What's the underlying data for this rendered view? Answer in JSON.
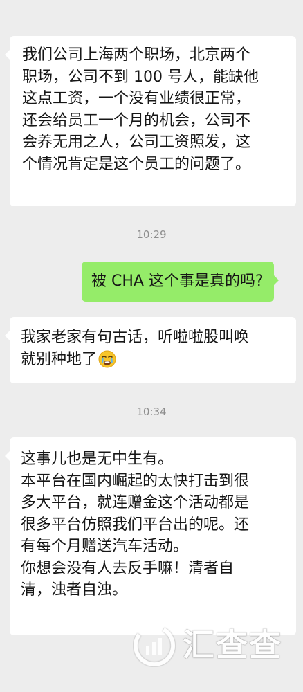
{
  "chat": {
    "messages": [
      {
        "direction": "incoming",
        "text": "我们公司上海两个职场，北京两个\n职场，公司不到 100 号人，能缺他\n这点工资，一个没有业绩很正常，\n还会给员工一个月的机会，公司不\n会养无用之人，公司工资照发，这\n个情况肯定是这个员工的问题了。"
      },
      {
        "direction": "outgoing",
        "text": "被 CHA 这个事是真的吗?"
      },
      {
        "direction": "incoming",
        "text": "我家老家有句古话，听啦啦股叫唤\n就别种地了",
        "emoji": "crying-face"
      },
      {
        "direction": "incoming",
        "text": "这事儿也是无中生有。\n本平台在国内崛起的太快打击到很\n多大平台，就连赠金这个活动都是\n很多平台仿照我们平台出的呢。还\n有每个月赠送汽车活动。\n你想会没有人去反手嘛！清者自\n清，浊者自浊。"
      }
    ],
    "timestamps": [
      "10:29",
      "10:34"
    ]
  },
  "watermark": {
    "text": "汇查查",
    "icon": "chart-circle-logo"
  },
  "colors": {
    "background": "#ededed",
    "incoming_bubble": "#ffffff",
    "outgoing_bubble": "#95ec69",
    "timestamp_text": "#8d8d8d"
  }
}
